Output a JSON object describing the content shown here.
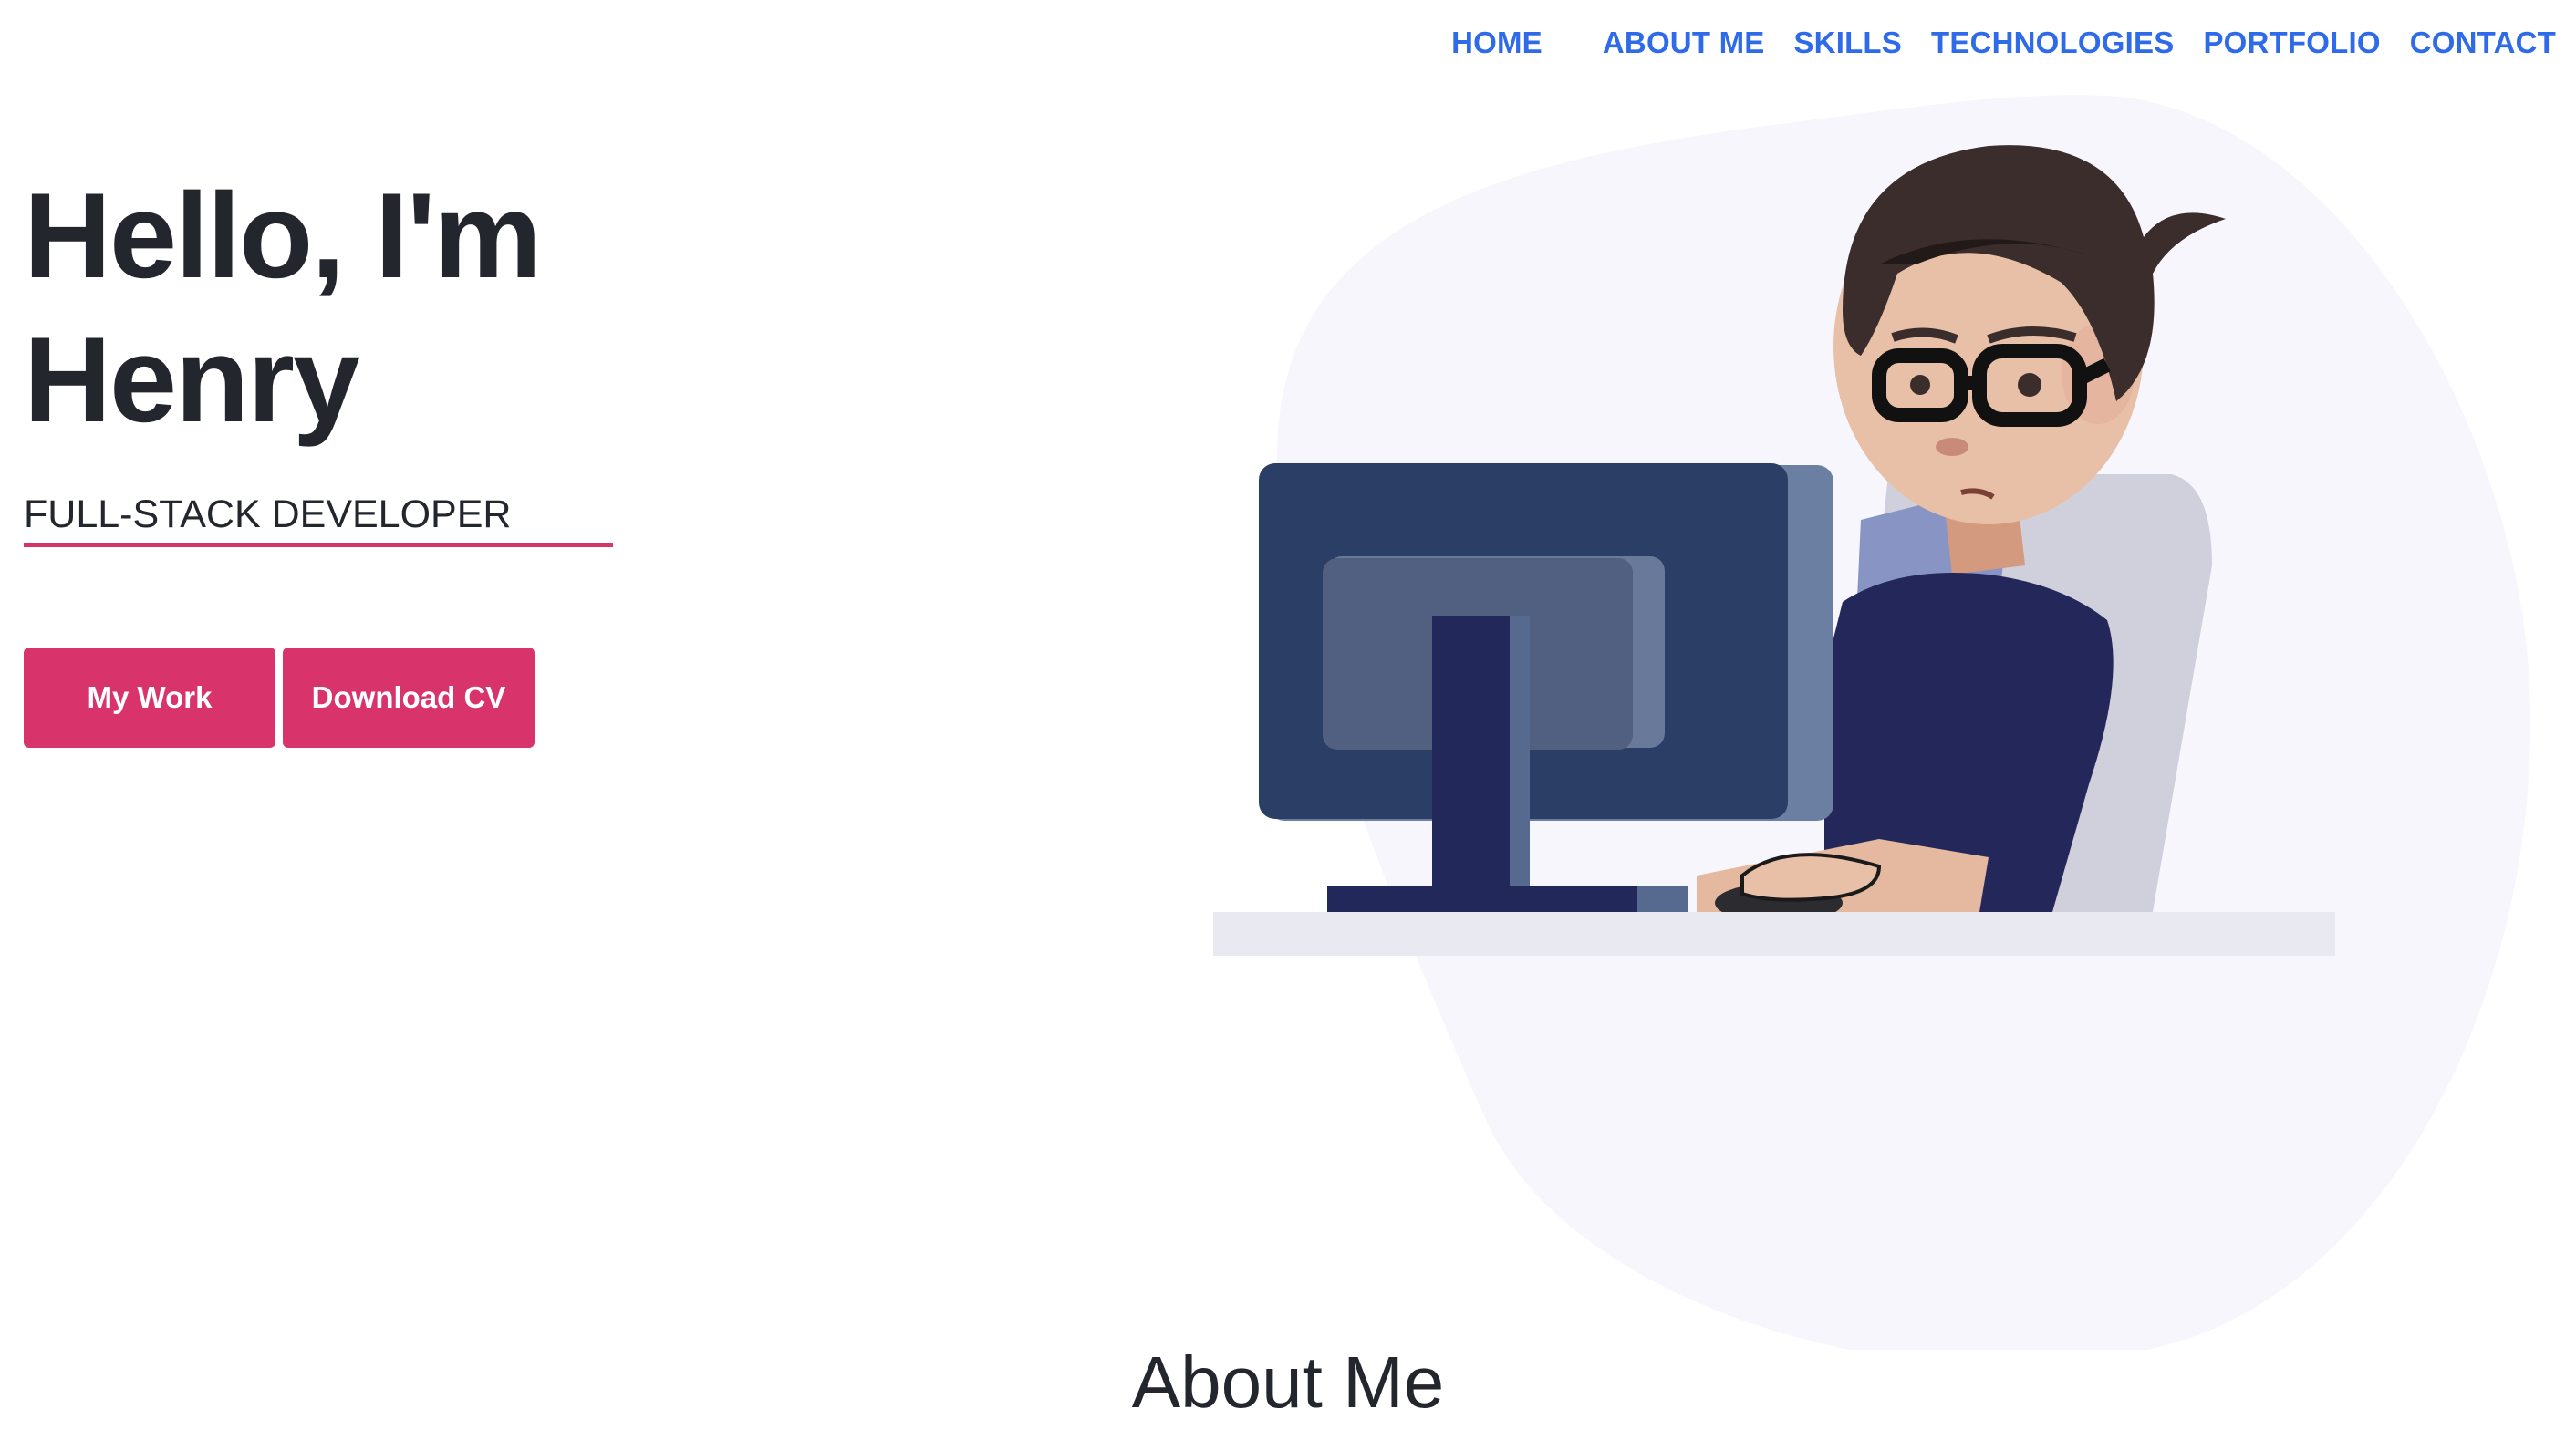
{
  "nav": {
    "items": [
      {
        "label": "HOME"
      },
      {
        "label": "ABOUT ME"
      },
      {
        "label": "SKILLS"
      },
      {
        "label": "TECHNOLOGIES"
      },
      {
        "label": "PORTFOLIO"
      },
      {
        "label": "CONTACT"
      }
    ]
  },
  "hero": {
    "greeting": "Hello, I'm",
    "name": "Henry",
    "role": "FULL-STACK DEVELOPER",
    "buttons": {
      "work": "My Work",
      "cv": "Download CV"
    }
  },
  "about": {
    "title": "About Me"
  },
  "colors": {
    "nav_link": "#2f6be8",
    "accent": "#d8336a",
    "text": "#23262d",
    "blob": "#f8f6fd"
  }
}
